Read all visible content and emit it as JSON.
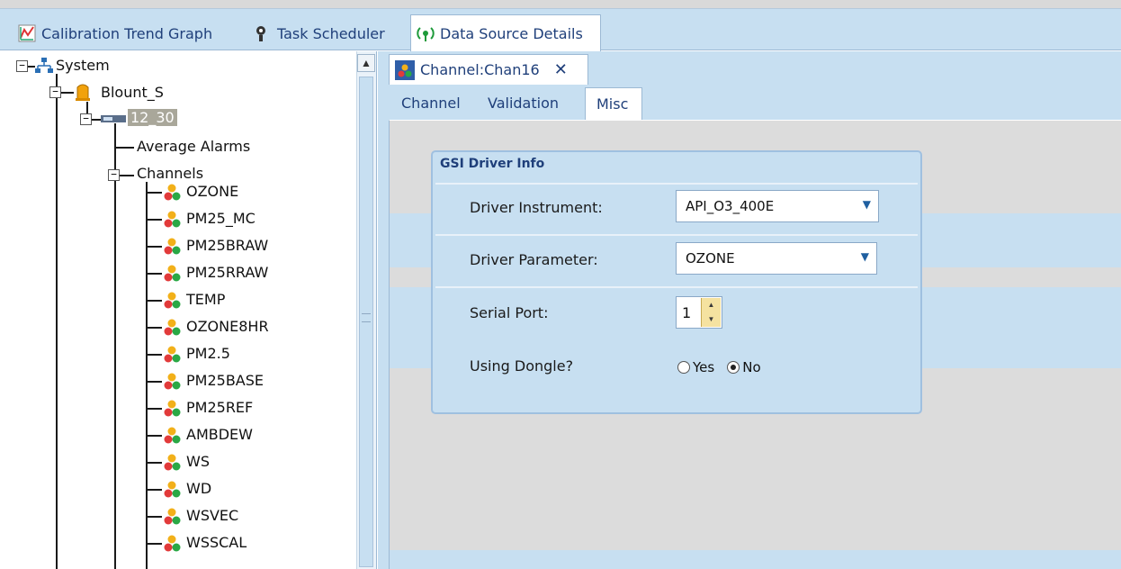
{
  "tabs": [
    {
      "label": "Calibration Trend Graph",
      "icon": "graph-icon"
    },
    {
      "label": "Task Scheduler",
      "icon": "gears-icon"
    },
    {
      "label": "Data Source Details",
      "icon": "antenna-icon"
    }
  ],
  "tree": {
    "root": "System",
    "site": "Blount_S",
    "logger": "12_30",
    "average_alarms": "Average Alarms",
    "channels_label": "Channels",
    "channels": [
      "OZONE",
      "PM25_MC",
      "PM25BRAW",
      "PM25RRAW",
      "TEMP",
      "OZONE8HR",
      "PM2.5",
      "PM25BASE",
      "PM25REF",
      "AMBDEW",
      "WS",
      "WD",
      "WSVEC",
      "WSSCAL"
    ]
  },
  "document_tab": {
    "label": "Channel:Chan16",
    "close": "✕"
  },
  "sub_tabs": [
    "Channel",
    "Validation",
    "Misc"
  ],
  "active_sub_tab": "Misc",
  "group": {
    "title": "GSI Driver Info",
    "driver_instrument_label": "Driver Instrument:",
    "driver_instrument_value": "API_O3_400E",
    "driver_parameter_label": "Driver Parameter:",
    "driver_parameter_value": "OZONE",
    "serial_port_label": "Serial Port:",
    "serial_port_value": "1",
    "dongle_label": "Using Dongle?",
    "dongle_yes": "Yes",
    "dongle_no": "No",
    "dongle_selected": "No"
  },
  "colors": {
    "accent": "#c7dff1",
    "tab_text": "#1f3f7a",
    "selected_node": "#a9a79a"
  }
}
